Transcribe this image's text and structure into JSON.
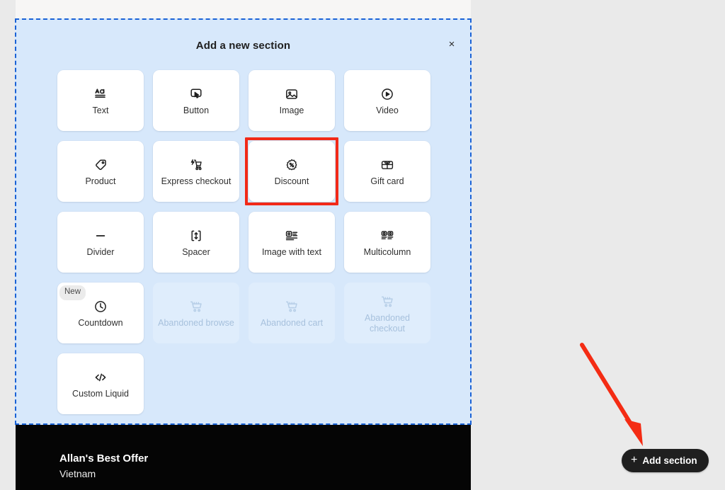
{
  "panel": {
    "title": "Add a new section",
    "close_label": "×"
  },
  "sections": [
    {
      "label": "Text",
      "icon": "text-icon",
      "state": "enabled"
    },
    {
      "label": "Button",
      "icon": "button-icon",
      "state": "enabled"
    },
    {
      "label": "Image",
      "icon": "image-icon",
      "state": "enabled"
    },
    {
      "label": "Video",
      "icon": "video-play-icon",
      "state": "enabled"
    },
    {
      "label": "Product",
      "icon": "product-tag-icon",
      "state": "enabled"
    },
    {
      "label": "Express checkout",
      "icon": "express-checkout-icon",
      "state": "enabled"
    },
    {
      "label": "Discount",
      "icon": "discount-badge-icon",
      "state": "highlighted"
    },
    {
      "label": "Gift card",
      "icon": "gift-card-icon",
      "state": "enabled"
    },
    {
      "label": "Divider",
      "icon": "divider-icon",
      "state": "enabled"
    },
    {
      "label": "Spacer",
      "icon": "spacer-icon",
      "state": "enabled"
    },
    {
      "label": "Image with text",
      "icon": "image-with-text-icon",
      "state": "enabled"
    },
    {
      "label": "Multicolumn",
      "icon": "multicolumn-icon",
      "state": "enabled"
    },
    {
      "label": "Countdown",
      "icon": "clock-icon",
      "state": "enabled",
      "badge": "New"
    },
    {
      "label": "Abandoned browse",
      "icon": "cart-icon",
      "state": "disabled"
    },
    {
      "label": "Abandoned cart",
      "icon": "cart-icon",
      "state": "disabled"
    },
    {
      "label": "Abandoned checkout",
      "icon": "cart-icon",
      "state": "disabled"
    },
    {
      "label": "Custom Liquid",
      "icon": "code-icon",
      "state": "enabled"
    }
  ],
  "store": {
    "name": "Allan's Best Offer",
    "region": "Vietnam"
  },
  "add_section_button": {
    "plus": "+",
    "label": "Add section"
  },
  "colors": {
    "panel_background": "#d7e8fb",
    "panel_border": "#1a62d6",
    "highlight": "#f22a18",
    "annotation_arrow": "#f42c14",
    "button_background": "#1f1f1f",
    "store_strip": "#050505"
  }
}
